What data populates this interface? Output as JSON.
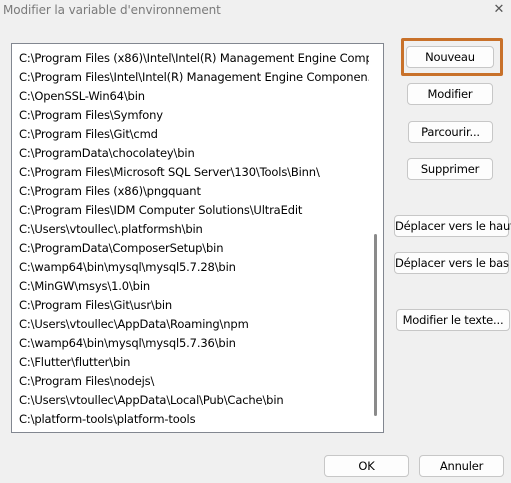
{
  "window": {
    "title": "Modifier la variable d'environnement",
    "close_glyph": "✕"
  },
  "path_entries": [
    "C:\\Program Files (x86)\\Intel\\Intel(R) Management Engine Comp...",
    "C:\\Program Files\\Intel\\Intel(R) Management Engine Componen...",
    "C:\\OpenSSL-Win64\\bin",
    "C:\\Program Files\\Symfony",
    "C:\\Program Files\\Git\\cmd",
    "C:\\ProgramData\\chocolatey\\bin",
    "C:\\Program Files\\Microsoft SQL Server\\130\\Tools\\Binn\\",
    "C:\\Program Files (x86)\\pngquant",
    "C:\\Program Files\\IDM Computer Solutions\\UltraEdit",
    "C:\\Users\\vtoullec\\.platformsh\\bin",
    "C:\\ProgramData\\ComposerSetup\\bin",
    "C:\\wamp64\\bin\\mysql\\mysql5.7.28\\bin",
    "C:\\MinGW\\msys\\1.0\\bin",
    "C:\\Program Files\\Git\\usr\\bin",
    "C:\\Users\\vtoullec\\AppData\\Roaming\\npm",
    "C:\\wamp64\\bin\\mysql\\mysql5.7.36\\bin",
    "C:\\Flutter\\flutter\\bin",
    "C:\\Program Files\\nodejs\\",
    "C:\\Users\\vtoullec\\AppData\\Local\\Pub\\Cache\\bin",
    "C:\\platform-tools\\platform-tools"
  ],
  "buttons": {
    "new": "Nouveau",
    "edit": "Modifier",
    "browse": "Parcourir...",
    "delete": "Supprimer",
    "move_up": "Déplacer vers le haut",
    "move_down": "Déplacer vers le bas",
    "edit_text": "Modifier le texte...",
    "ok": "OK",
    "cancel": "Annuler"
  },
  "colors": {
    "highlight": "#c8712a"
  }
}
